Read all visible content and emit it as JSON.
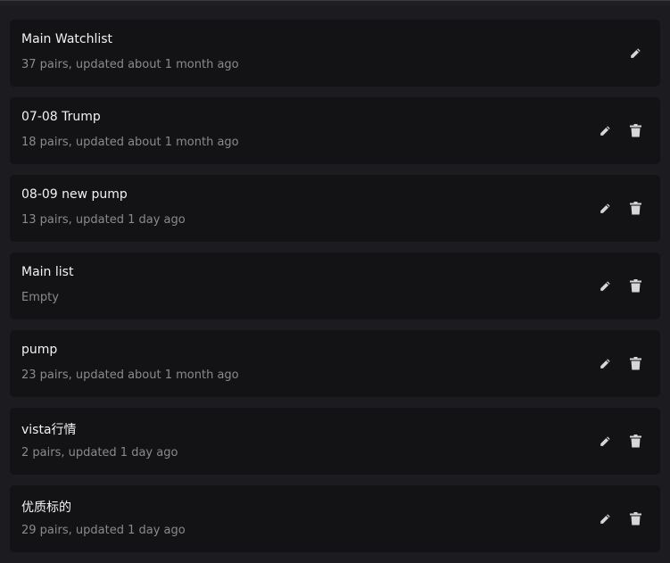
{
  "watchlists": [
    {
      "name": "Main Watchlist",
      "details": "37 pairs, updated about 1 month ago",
      "deletable": false
    },
    {
      "name": "07-08 Trump",
      "details": "18 pairs, updated about 1 month ago",
      "deletable": true
    },
    {
      "name": "08-09 new pump",
      "details": "13 pairs, updated 1 day ago",
      "deletable": true
    },
    {
      "name": "Main list",
      "details": "Empty",
      "deletable": true
    },
    {
      "name": "pump",
      "details": "23 pairs, updated about 1 month ago",
      "deletable": true
    },
    {
      "name": "vista行情",
      "details": "2 pairs, updated 1 day ago",
      "deletable": true
    },
    {
      "name": "优质标的",
      "details": "29 pairs, updated 1 day ago",
      "deletable": true
    }
  ],
  "icons": {
    "edit": "pencil-icon",
    "delete": "trash-icon"
  },
  "colors": {
    "background": "#1c1c20",
    "card": "#131315",
    "title": "#f2f2f2",
    "subtitle": "#8a8a8e",
    "icon": "#d6d6d6"
  }
}
